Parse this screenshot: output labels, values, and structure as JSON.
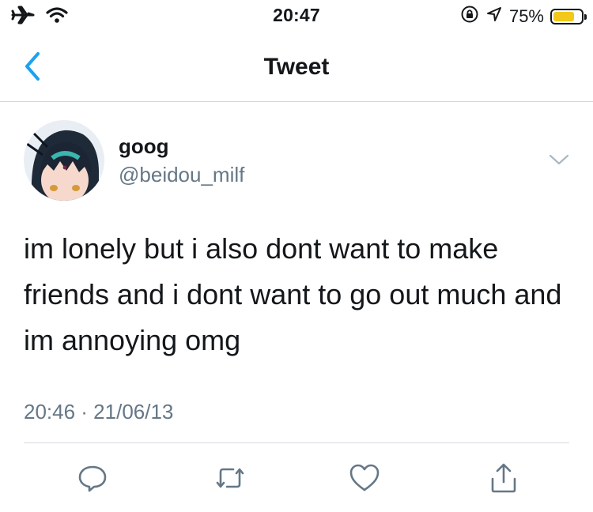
{
  "status_bar": {
    "time": "20:47",
    "battery_percent": "75%",
    "battery_level": 0.75,
    "icons": [
      "airplane-icon",
      "wifi-icon",
      "orientation-lock-icon",
      "location-icon",
      "battery-icon"
    ]
  },
  "nav": {
    "title": "Tweet",
    "back_icon": "chevron-left-icon"
  },
  "tweet": {
    "author_name": "goog",
    "author_handle": "@beidou_milf",
    "text": "im lonely but i also dont want to make friends and i dont want to go out much and im annoying omg",
    "timestamp": "20:46 · 21/06/13"
  },
  "actions": [
    "reply-icon",
    "retweet-icon",
    "like-icon",
    "share-icon"
  ],
  "colors": {
    "accent": "#1da1f2",
    "text_primary": "#14171a",
    "text_secondary": "#657786",
    "divider": "#d6dade",
    "battery_fill": "#f2c81a"
  }
}
